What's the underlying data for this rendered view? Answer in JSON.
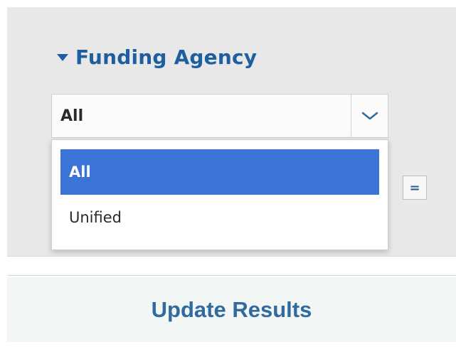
{
  "filter": {
    "section_title": "Funding Agency",
    "select_value": "All",
    "options": [
      {
        "label": "All",
        "selected": true
      },
      {
        "label": "Unified",
        "selected": false
      }
    ],
    "equals_label": "="
  },
  "actions": {
    "update_label": "Update Results"
  },
  "icons": {
    "expand": "triangle-down-icon",
    "dropdown": "chevron-down-icon"
  },
  "colors": {
    "accent": "#1f5f9f",
    "selected_option": "#3b73d6",
    "panel_bg": "#e8e8e8",
    "button_text": "#2f6aa0"
  }
}
